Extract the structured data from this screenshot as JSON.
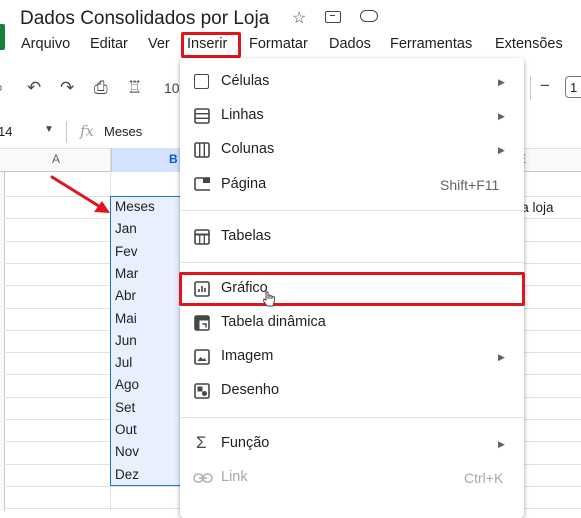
{
  "document": {
    "title": "Dados Consolidados por Loja"
  },
  "menubar": {
    "items": [
      "Arquivo",
      "Editar",
      "Ver",
      "Inserir",
      "Formatar",
      "Dados",
      "Ferramentas",
      "Extensões"
    ],
    "active": "Inserir"
  },
  "toolbar": {
    "zoom": "10",
    "font_size": "1"
  },
  "formula_bar": {
    "cell_ref": "14",
    "fx": "fx",
    "value": "Meses"
  },
  "grid": {
    "columns": [
      "A",
      "B",
      "E"
    ],
    "column_b_values": [
      "Meses",
      "Jan",
      "Fev",
      "Mar",
      "Abr",
      "Mai",
      "Jun",
      "Jul",
      "Ago",
      "Set",
      "Out",
      "Nov",
      "Dez"
    ],
    "column_e_text": "a a loja"
  },
  "insert_menu": {
    "items": [
      {
        "label": "Células",
        "submenu": true,
        "icon": "cells-icon"
      },
      {
        "label": "Linhas",
        "submenu": true,
        "icon": "rows-icon"
      },
      {
        "label": "Colunas",
        "submenu": true,
        "icon": "columns-icon"
      },
      {
        "label": "Página",
        "shortcut": "Shift+F11",
        "icon": "page-icon"
      },
      {
        "label": "Tabelas",
        "icon": "table-icon"
      },
      {
        "label": "Gráfico",
        "icon": "chart-icon",
        "highlighted": true
      },
      {
        "label": "Tabela dinâmica",
        "icon": "pivot-table-icon"
      },
      {
        "label": "Imagem",
        "submenu": true,
        "icon": "image-icon"
      },
      {
        "label": "Desenho",
        "icon": "drawing-icon"
      },
      {
        "label": "Função",
        "submenu": true,
        "icon": "sigma-icon"
      },
      {
        "label": "Link",
        "shortcut": "Ctrl+K",
        "icon": "link-icon",
        "disabled": true
      }
    ]
  },
  "colors": {
    "highlight_red": "#e0141e",
    "selection_blue": "#1a73e8",
    "sheets_green": "#188038"
  }
}
